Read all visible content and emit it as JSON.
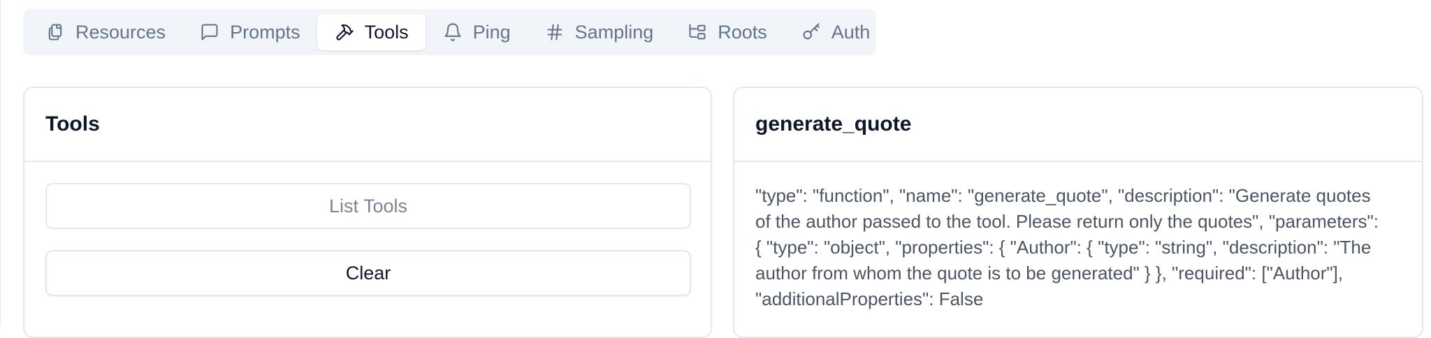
{
  "tabs": [
    {
      "label": "Resources",
      "icon": "files-icon"
    },
    {
      "label": "Prompts",
      "icon": "message-square-icon"
    },
    {
      "label": "Tools",
      "icon": "hammer-icon",
      "active": true
    },
    {
      "label": "Ping",
      "icon": "bell-icon"
    },
    {
      "label": "Sampling",
      "icon": "hash-icon"
    },
    {
      "label": "Roots",
      "icon": "folder-tree-icon"
    },
    {
      "label": "Auth",
      "icon": "key-icon"
    }
  ],
  "tools_panel": {
    "title": "Tools",
    "list_button": "List Tools",
    "clear_button": "Clear"
  },
  "detail_panel": {
    "title": "generate_quote",
    "description": "\"type\": \"function\", \"name\": \"generate_quote\", \"description\": \"Generate quotes of the author passed to the tool. Please return only the quotes\", \"parameters\": { \"type\": \"object\", \"properties\": { \"Author\": { \"type\": \"string\", \"description\": \"The author from whom the quote is to be generated\" } }, \"required\": [\"Author\"], \"additionalProperties\": False"
  }
}
